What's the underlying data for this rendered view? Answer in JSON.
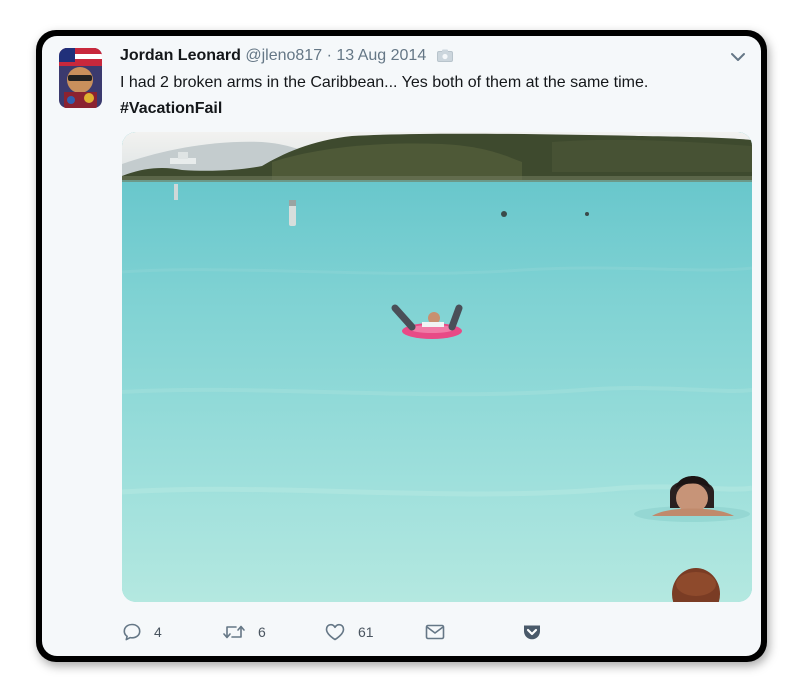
{
  "tweet": {
    "author_name": "Jordan Leonard",
    "handle": "@jleno817",
    "separator": "·",
    "date": "13 Aug 2014",
    "text": "I had 2 broken arms in the Caribbean... Yes both of them at the same time.",
    "hashtag": "#VacationFail"
  },
  "actions": {
    "reply_count": "4",
    "retweet_count": "6",
    "like_count": "61"
  },
  "icons": {
    "avatar": "avatar",
    "camera": "camera-icon",
    "menu": "chevron-down-icon",
    "reply": "reply-icon",
    "retweet": "retweet-icon",
    "like": "heart-icon",
    "message": "envelope-icon",
    "pocket": "pocket-icon"
  },
  "colors": {
    "card_bg": "#f5f8fa",
    "secondary_text": "#657786",
    "pocket": "#4a5a6a"
  }
}
